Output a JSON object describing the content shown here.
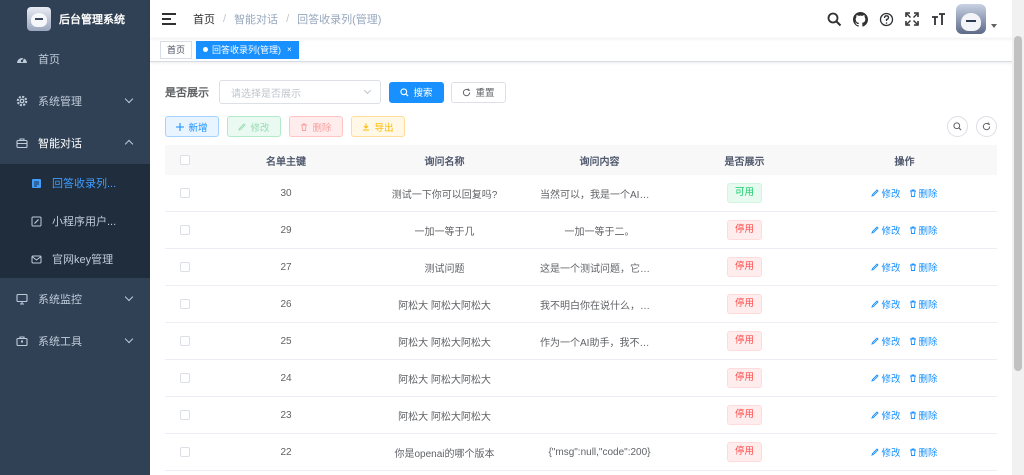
{
  "app": {
    "title": "后台管理系统"
  },
  "sidebar": {
    "items": [
      {
        "label": "首页",
        "icon": "dashboard-icon"
      },
      {
        "label": "系统管理",
        "icon": "gear-icon"
      },
      {
        "label": "智能对话",
        "icon": "briefcase-icon",
        "expanded": true
      },
      {
        "label": "系统监控",
        "icon": "monitor-icon"
      },
      {
        "label": "系统工具",
        "icon": "toolbox-icon"
      }
    ],
    "subitems": [
      {
        "label": "回答收录列...",
        "icon": "list-icon",
        "active": true
      },
      {
        "label": "小程序用户...",
        "icon": "edit-icon"
      },
      {
        "label": "官网key管理",
        "icon": "mail-icon"
      }
    ]
  },
  "breadcrumb": [
    "首页",
    "智能对话",
    "回答收录列(管理)"
  ],
  "tags": [
    {
      "label": "首页",
      "active": false
    },
    {
      "label": "回答收录列(管理)",
      "active": true
    }
  ],
  "search": {
    "label": "是否展示",
    "placeholder": "请选择是否展示",
    "search_button": "搜索",
    "reset_button": "重置"
  },
  "toolbar": {
    "add": "新增",
    "edit": "修改",
    "delete": "删除",
    "export": "导出"
  },
  "table": {
    "headers": [
      "名单主键",
      "询问名称",
      "询问内容",
      "是否展示",
      "操作"
    ],
    "rows": [
      {
        "id": "30",
        "name": "测试一下你可以回复吗?",
        "content": "当然可以，我是一个AI语言...",
        "status": "可用",
        "status_type": "ok"
      },
      {
        "id": "29",
        "name": "一加一等于几",
        "content": "一加一等于二。",
        "status": "停用",
        "status_type": "off"
      },
      {
        "id": "27",
        "name": "测试问题",
        "content": "这是一个测试问题，它没有...",
        "status": "停用",
        "status_type": "off"
      },
      {
        "id": "26",
        "name": "阿松大 阿松大阿松大",
        "content": "我不明白你在说什么，请提...",
        "status": "停用",
        "status_type": "off"
      },
      {
        "id": "25",
        "name": "阿松大 阿松大阿松大",
        "content": "作为一个AI助手，我不理解\"...",
        "status": "停用",
        "status_type": "off"
      },
      {
        "id": "24",
        "name": "阿松大 阿松大阿松大",
        "content": "",
        "status": "停用",
        "status_type": "off"
      },
      {
        "id": "23",
        "name": "阿松大 阿松大阿松大",
        "content": "",
        "status": "停用",
        "status_type": "off"
      },
      {
        "id": "22",
        "name": "你是openai的哪个版本",
        "content": "{\"msg\":null,\"code\":200}",
        "status": "停用",
        "status_type": "off"
      }
    ],
    "op_edit": "修改",
    "op_delete": "删除"
  },
  "colors": {
    "sidebar_bg": "#304156",
    "primary": "#1890ff",
    "success": "#13ce66",
    "danger": "#ff4949"
  }
}
